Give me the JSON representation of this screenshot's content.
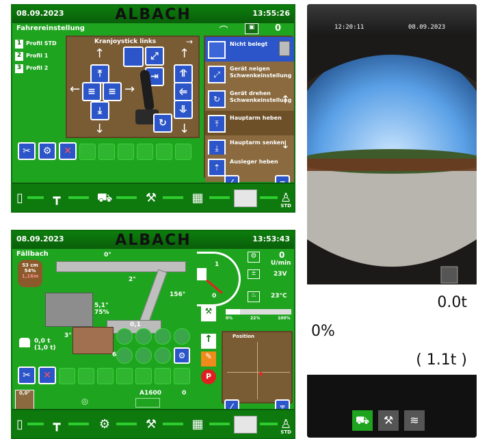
{
  "screen1": {
    "date": "08.09.2023",
    "brand": "ALBACH",
    "time": "13:55:26",
    "title": "Fahrereinstellung",
    "counter": "0",
    "profiles": [
      {
        "num": "1",
        "label": "Profil STD"
      },
      {
        "num": "2",
        "label": "Profil 1"
      },
      {
        "num": "3",
        "label": "Profil 2"
      }
    ],
    "joystick_label": "Kranjoystick links",
    "menu": [
      {
        "label": "Nicht belegt"
      },
      {
        "label": "Gerät neigen Schwenkeinstellung"
      },
      {
        "label": "Gerät drehen Schwenkeinstellung"
      },
      {
        "label": "Hauptarm heben"
      },
      {
        "label": "Hauptarm senken"
      },
      {
        "label": "Ausleger heben"
      }
    ],
    "bottom_label": "STD"
  },
  "screen2": {
    "date": "08.09.2023",
    "brand": "ALBACH",
    "time": "13:53:43",
    "title": "Fällbach",
    "rpm_value": "0",
    "rpm_unit": "U/min",
    "voltage": "23V",
    "temperature": "23°C",
    "badge_lines": [
      "53 cm",
      "54%",
      "1,16m"
    ],
    "crane_angle_top": "0°",
    "crane_angle_mid": "2°",
    "crane_angle_right": "156°",
    "crane_value_a": "5,1°",
    "crane_value_b": "75%",
    "crane_value_c": "0,1",
    "crane_value_d": "3°",
    "crane_value_e": "69°",
    "weight_now": "0,0 t",
    "weight_total": "(1,0 t)",
    "gauge_ticks": [
      "1",
      "0"
    ],
    "bar_scale": [
      "0%",
      "22%",
      "100%"
    ],
    "position_title": "Position",
    "bottom_values": [
      "0,0°",
      "A1600",
      "0"
    ],
    "bottom_label": "STD"
  },
  "camera": {
    "time": "12:20:11",
    "date": "08.09.2023",
    "load_now": "0.0t",
    "percent": "0%",
    "load_total": "( 1.1t )"
  }
}
